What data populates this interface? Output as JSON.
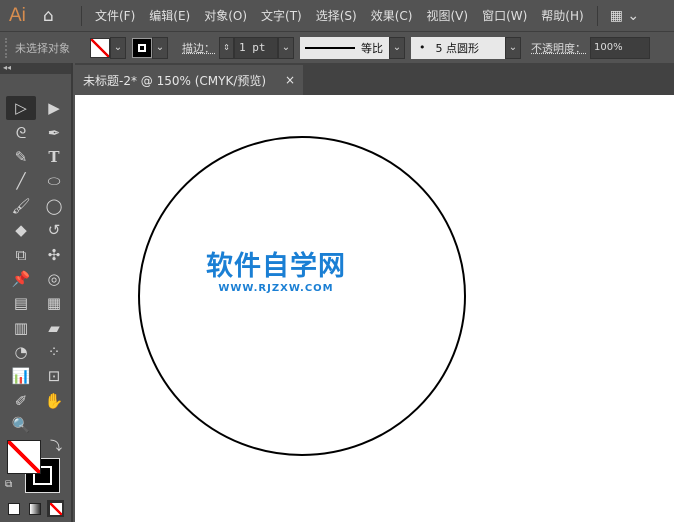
{
  "app": {
    "logo": "Ai"
  },
  "menu": [
    "文件(F)",
    "编辑(E)",
    "对象(O)",
    "文字(T)",
    "选择(S)",
    "效果(C)",
    "视图(V)",
    "窗口(W)",
    "帮助(H)"
  ],
  "control": {
    "selection": "未选择对象",
    "stroke_label": "描边：",
    "stroke_value": "1 pt",
    "profile": "等比",
    "brush": "5 点圆形",
    "opacity_label": "不透明度：",
    "opacity_value": "100%"
  },
  "document": {
    "tab_title": "未标题-2* @ 150% (CMYK/预览)",
    "close": "×"
  },
  "watermark": {
    "title": "软件自学网",
    "url": "WWW.RJZXW.COM",
    "color": "#1a7fd4"
  },
  "colors": {
    "fill": "none",
    "stroke": "#000000"
  }
}
